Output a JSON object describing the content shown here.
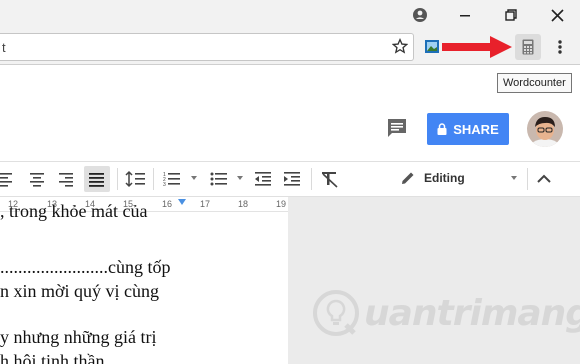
{
  "browser": {
    "address_text": "t",
    "tooltip": "Wordcounter"
  },
  "header": {
    "share_label": "SHARE"
  },
  "toolbar": {
    "mode_label": "Editing"
  },
  "ruler": {
    "ticks": [
      "12",
      "13",
      "14",
      "15",
      "16",
      "17",
      "18",
      "19"
    ]
  },
  "document": {
    "lines": [
      ", trong khỏe mát của",
      "........................cùng tốp",
      "n xin mời quý vị cùng",
      "y nhưng những giá trị",
      "h hội tinh thần"
    ]
  },
  "watermark": {
    "text": "uantrimang"
  },
  "colors": {
    "share_blue": "#4285f4",
    "arrow_red": "#e8212b"
  }
}
